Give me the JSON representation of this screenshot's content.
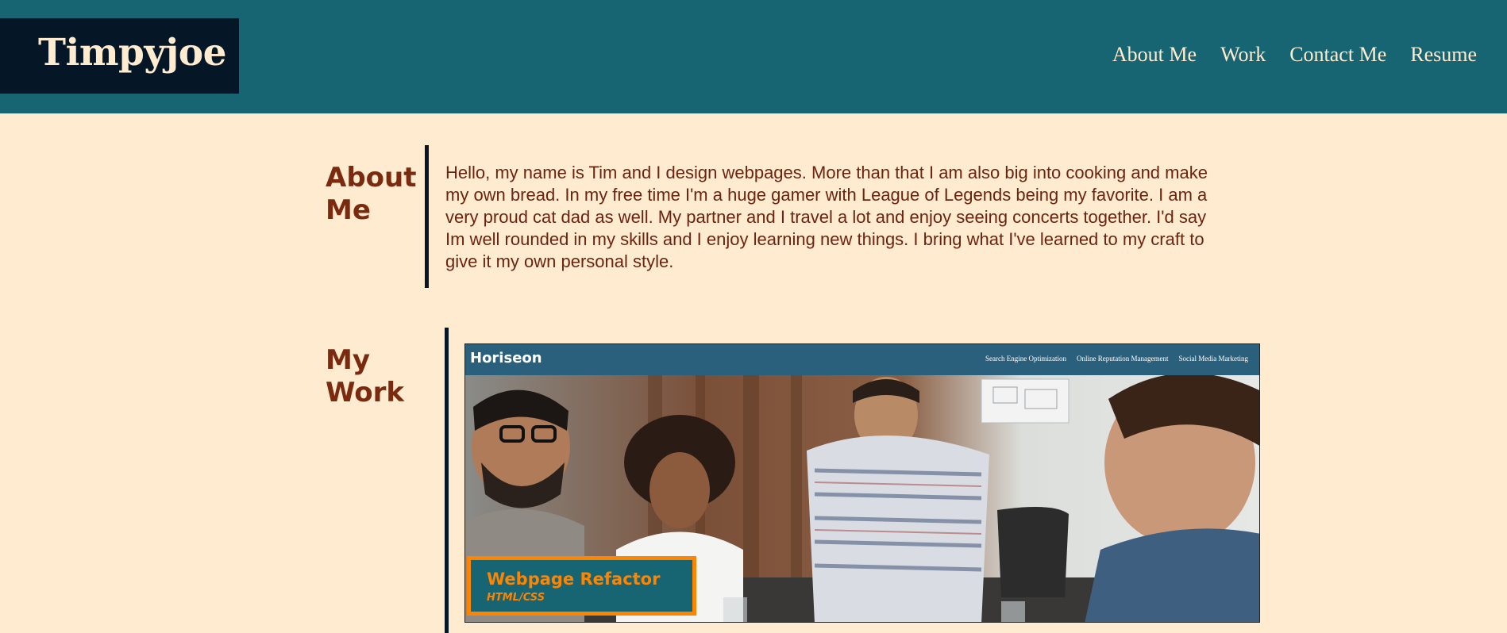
{
  "header": {
    "logo": "Timpyjoe",
    "nav": [
      "About Me",
      "Work",
      "Contact Me",
      "Resume"
    ]
  },
  "about": {
    "title_line1": "About",
    "title_line2": "Me",
    "text": "Hello, my name is Tim and I design webpages. More than that I am also big into cooking and make my own bread. In my free time I'm a huge gamer with League of Legends being my favorite. I am a very proud cat dad as well. My partner and I travel a lot and enjoy seeing concerts together. I'd say Im well rounded in my skills and I enjoy learning new things. I bring what I've learned to my craft to give it my own personal style."
  },
  "work": {
    "title_line1": "My",
    "title_line2": "Work",
    "card": {
      "brand": "Horiseon",
      "nav": [
        "Search Engine Optimization",
        "Online Reputation Management",
        "Social Media Marketing"
      ],
      "caption_title": "Webpage Refactor",
      "caption_sub": "HTML/CSS"
    }
  },
  "colors": {
    "header_bg": "#176572",
    "logo_bg": "#051626",
    "page_bg": "#ffebd0",
    "heading": "#7a2a0e",
    "accent": "#ff8400"
  }
}
